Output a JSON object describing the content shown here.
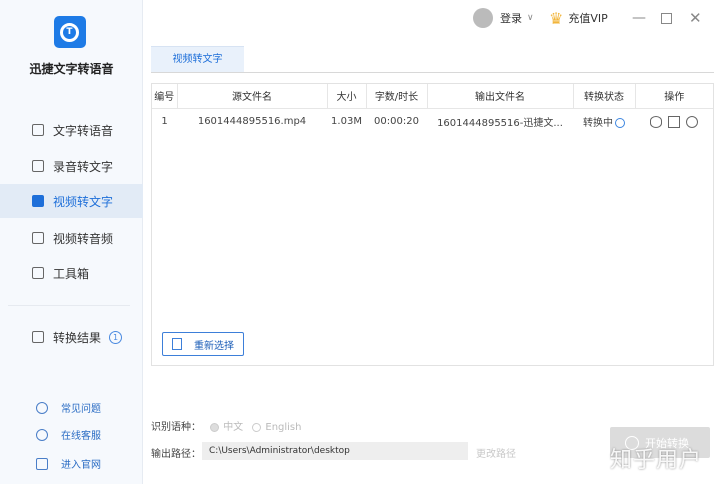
{
  "app": {
    "name": "迅捷文字转语音"
  },
  "sidebar": {
    "items": [
      {
        "label": "文字转语音"
      },
      {
        "label": "录音转文字"
      },
      {
        "label": "视频转文字"
      },
      {
        "label": "视频转音频"
      },
      {
        "label": "工具箱"
      }
    ],
    "results": {
      "label": "转换结果",
      "count": "1"
    },
    "help": [
      {
        "label": "常见问题"
      },
      {
        "label": "在线客服"
      },
      {
        "label": "进入官网"
      }
    ]
  },
  "topbar": {
    "login": "登录",
    "vip": "充值VIP"
  },
  "tab": {
    "label": "视频转文字"
  },
  "table": {
    "headers": [
      "编号",
      "源文件名",
      "大小",
      "字数/时长",
      "输出文件名",
      "转换状态",
      "操作"
    ],
    "rows": [
      {
        "no": "1",
        "source": "1601444895516.mp4",
        "size": "1.03M",
        "duration": "00:00:20",
        "output": "1601444895516-迅捷文...",
        "status": "转换中"
      }
    ]
  },
  "reselect": "重新选择",
  "language": {
    "label": "识别语种：",
    "options": [
      "中文",
      "English"
    ],
    "selected": "中文"
  },
  "output": {
    "label": "输出路径：",
    "path": "C:\\Users\\Administrator\\desktop",
    "change": "更改路径"
  },
  "start": "开始转换",
  "watermark": "知乎用户"
}
